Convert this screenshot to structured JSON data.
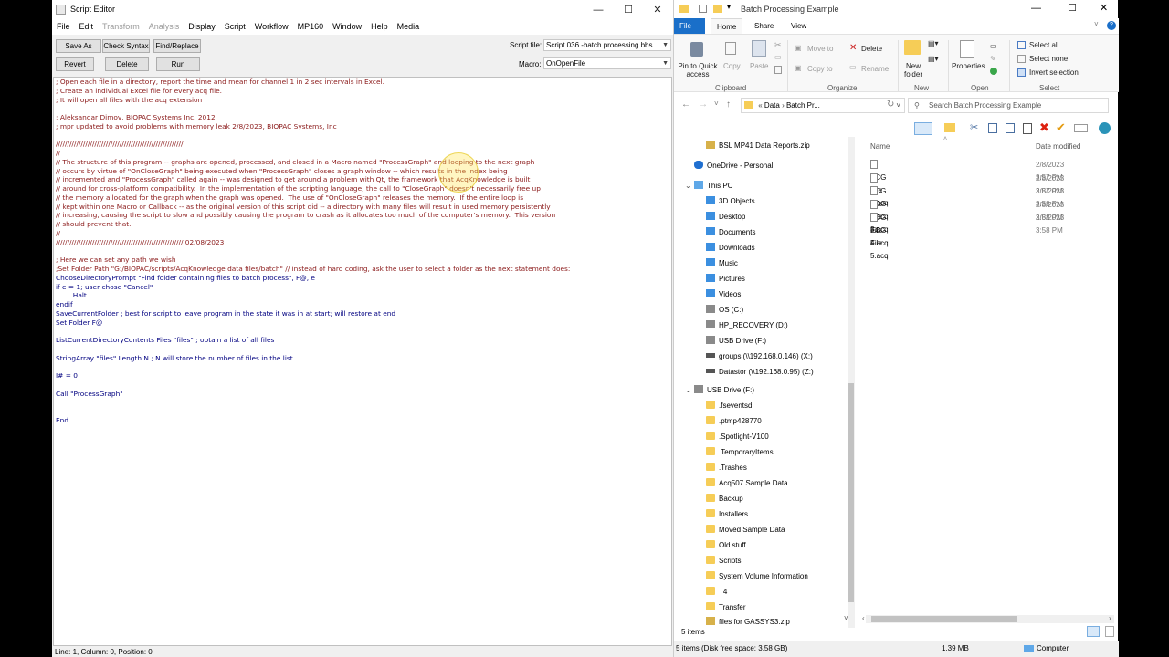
{
  "editor": {
    "title": "Script Editor",
    "window_buttons": {
      "minimize": "—",
      "maximize": "☐",
      "close": "✕"
    },
    "menu": [
      {
        "label": "File",
        "enabled": true
      },
      {
        "label": "Edit",
        "enabled": true
      },
      {
        "label": "Transform",
        "enabled": false
      },
      {
        "label": "Analysis",
        "enabled": false
      },
      {
        "label": "Display",
        "enabled": true
      },
      {
        "label": "Script",
        "enabled": true
      },
      {
        "label": "Workflow",
        "enabled": true
      },
      {
        "label": "MP160",
        "enabled": true
      },
      {
        "label": "Window",
        "enabled": true
      },
      {
        "label": "Help",
        "enabled": true
      },
      {
        "label": "Media",
        "enabled": true
      }
    ],
    "buttons": {
      "save_as": "Save As",
      "check_syntax": "Check Syntax",
      "find_replace": "Find/Replace",
      "revert": "Revert",
      "delete": "Delete",
      "run": "Run"
    },
    "script_file_label": "Script file:",
    "script_file_value": "Script 036 -batch processing.bbs",
    "macro_label": "Macro:",
    "macro_value": "OnOpenFile",
    "code_lines": [
      "; Open each file in a directory, report the time and mean for channel 1 in 2 sec intervals in Excel.",
      "; Create an individual Excel file for every acq file.",
      "; It will open all files with the acq extension",
      "",
      "; Aleksandar Dimov, BIOPAC Systems Inc. 2012",
      "; mpr updated to avoid problems with memory leak 2/8/2023, BIOPAC Systems, Inc",
      "",
      "////////////////////////////////////////////////////////",
      "//",
      "// The structure of this program -- graphs are opened, processed, and closed in a Macro named \"ProcessGraph\" and looping to the next graph",
      "// occurs by virtue of \"OnCloseGraph\" being executed when \"ProcessGraph\" closes a graph window -- which results in the index being",
      "// incremented and \"ProcessGraph\" called again -- was designed to get around a problem with Qt, the framework that AcqKnowledge is built",
      "// around for cross-platform compatibility.  In the implementation of the scripting language, the call to \"CloseGraph\" doesn't necessarily free up",
      "// the memory allocated for the graph when the graph was opened.  The use of \"OnCloseGraph\" releases the memory.  If the entire loop is",
      "// kept within one Macro or Callback -- as the original version of this script did -- a directory with many files will result in used memory persistently",
      "// increasing, causing the script to slow and possibly causing the program to crash as it allocates too much of the computer's memory.  This version",
      "// should prevent that.",
      "//",
      "//////////////////////////////////////////////////////// 02/08/2023",
      "",
      "; Here we can set any path we wish",
      ";Set Folder Path \"G:/BIOPAC/scripts/AcqKnowledge data files/batch\" // instead of hard coding, ask the user to select a folder as the next statement does:",
      "ChooseDirectoryPrompt \"Find folder containing files to batch process\", F@, e",
      "if e = 1; user chose \"Cancel\"",
      "        Halt",
      "endif",
      "SaveCurrentFolder ; best for script to leave program in the state it was in at start; will restore at end",
      "Set Folder F@",
      "",
      "ListCurrentDirectoryContents Files \"files\" ; obtain a list of all files",
      "",
      "StringArray \"files\" Length N ; N will store the number of files in the list",
      "",
      "I# = 0",
      "",
      "Call \"ProcessGraph\"",
      "",
      "",
      "End"
    ],
    "status": "Line: 1, Column: 0, Position: 0"
  },
  "explorer": {
    "title": "Batch Processing Example",
    "tabs": [
      "File",
      "Home",
      "Share",
      "View"
    ],
    "active_tab": "Home",
    "ribbon": {
      "clipboard": {
        "pin": "Pin to Quick access",
        "copy": "Copy",
        "paste": "Paste",
        "group": "Clipboard"
      },
      "organize": {
        "move_to": "Move to",
        "copy_to": "Copy to",
        "delete": "Delete",
        "rename": "Rename",
        "group": "Organize"
      },
      "new": {
        "new_folder": "New folder",
        "group": "New"
      },
      "open": {
        "properties": "Properties",
        "group": "Open"
      },
      "select": {
        "select_all": "Select all",
        "select_none": "Select none",
        "invert": "Invert selection",
        "group": "Select"
      }
    },
    "breadcrumb": [
      "Data",
      "Batch Pr..."
    ],
    "search_placeholder": "Search Batch Processing Example",
    "tree": [
      {
        "label": "BSL MP41 Data Reports.zip",
        "type": "zip"
      },
      {
        "label": "OneDrive - Personal",
        "type": "cloud"
      },
      {
        "label": "This PC",
        "type": "pc"
      },
      {
        "label": "3D Objects",
        "type": "blue"
      },
      {
        "label": "Desktop",
        "type": "blue"
      },
      {
        "label": "Documents",
        "type": "blue"
      },
      {
        "label": "Downloads",
        "type": "blue"
      },
      {
        "label": "Music",
        "type": "blue"
      },
      {
        "label": "Pictures",
        "type": "blue"
      },
      {
        "label": "Videos",
        "type": "blue"
      },
      {
        "label": "OS (C:)",
        "type": "drive"
      },
      {
        "label": "HP_RECOVERY (D:)",
        "type": "drive"
      },
      {
        "label": "USB Drive (F:)",
        "type": "drive"
      },
      {
        "label": "groups (\\\\192.168.0.146) (X:)",
        "type": "net"
      },
      {
        "label": "Datastor (\\\\192.168.0.95) (Z:)",
        "type": "net"
      },
      {
        "label": "USB Drive (F:)",
        "type": "drive"
      },
      {
        "label": ".fseventsd",
        "type": "folder"
      },
      {
        "label": ".ptmp428770",
        "type": "folder"
      },
      {
        "label": ".Spotlight-V100",
        "type": "folder"
      },
      {
        "label": ".TemporaryItems",
        "type": "folder"
      },
      {
        "label": ".Trashes",
        "type": "folder"
      },
      {
        "label": "Acq507 Sample Data",
        "type": "folder"
      },
      {
        "label": "Backup",
        "type": "folder"
      },
      {
        "label": "Installers",
        "type": "folder"
      },
      {
        "label": "Moved Sample Data",
        "type": "folder"
      },
      {
        "label": "Old stuff",
        "type": "folder"
      },
      {
        "label": "Scripts",
        "type": "folder"
      },
      {
        "label": "System Volume Information",
        "type": "folder"
      },
      {
        "label": "T4",
        "type": "folder"
      },
      {
        "label": "Transfer",
        "type": "folder"
      },
      {
        "label": "files for GASSYS3.zip",
        "type": "zip"
      }
    ],
    "columns": {
      "name": "Name",
      "date": "Date modified"
    },
    "files": [
      {
        "name": "ECG File 1.acq",
        "date": "2/8/2023 3:57 PM"
      },
      {
        "name": "ECG File 2.acq",
        "date": "2/8/2023 3:57 PM"
      },
      {
        "name": "ECG File 3.acq",
        "date": "2/8/2023 3:58 PM"
      },
      {
        "name": "ECG File 4.acq",
        "date": "2/8/2023 3:58 PM"
      },
      {
        "name": "ECG File 5.acq",
        "date": "2/8/2023 3:58 PM"
      }
    ],
    "item_count": "5 items",
    "status": {
      "left": "5 items (Disk free space: 3.58 GB)",
      "size": "1.39 MB",
      "location": "Computer"
    }
  }
}
